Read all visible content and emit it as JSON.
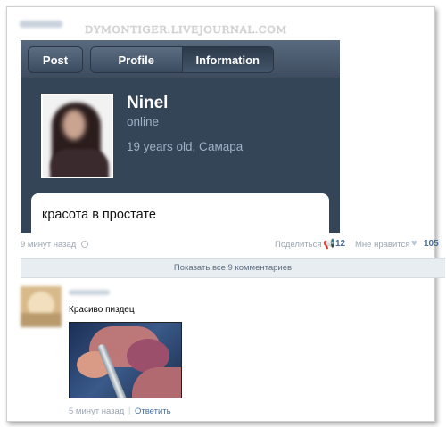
{
  "watermark": "DYMONTIGER.LIVEJOURNAL.COM",
  "embedded_app": {
    "nav": {
      "back_button": "Post",
      "segments": [
        "Profile",
        "Information"
      ],
      "active_segment": "Information"
    },
    "profile": {
      "name": "Ninel",
      "status": "online",
      "info": "19 years old, Самара"
    },
    "post_text": "красота в простате",
    "colors": {
      "background": "#344558",
      "secondary_text": "#9fb0c4"
    }
  },
  "post_meta": {
    "time": "9 минут назад",
    "share_label": "Поделиться",
    "share_count": "12",
    "like_label": "Мне нравится",
    "like_count": "105"
  },
  "show_comments": "Показать все 9 комментариев",
  "comment": {
    "text": "Красиво пиздец",
    "time": "5 минут назад",
    "separator": "|",
    "reply": "Ответить"
  },
  "icons": {
    "clock": "clock-icon",
    "share": "megaphone-icon",
    "like": "heart-icon"
  }
}
